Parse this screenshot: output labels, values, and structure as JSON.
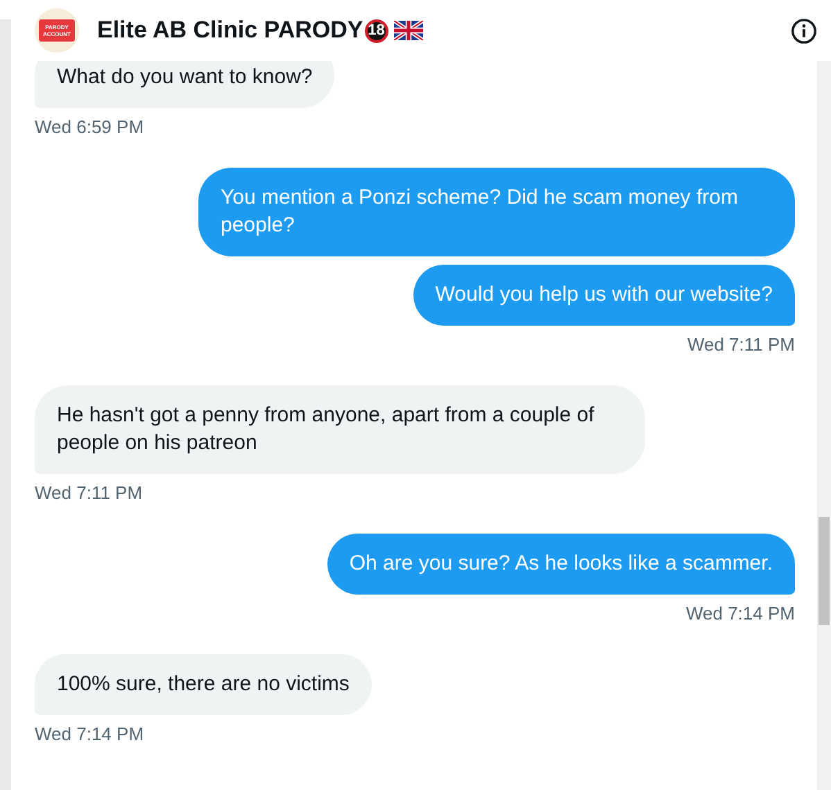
{
  "header": {
    "avatar_text": "PARODY ACCOUNT",
    "name": "Elite AB Clinic PARODY",
    "age_badge": "18"
  },
  "messages": [
    {
      "kind": "received",
      "text": "What do you want to know?",
      "timestamp": "Wed 6:59 PM"
    },
    {
      "kind": "sent",
      "text": "You mention a Ponzi scheme? Did he scam money from people?"
    },
    {
      "kind": "sent",
      "text": "Would you help us with our website?",
      "timestamp": "Wed 7:11 PM"
    },
    {
      "kind": "received",
      "text": "He hasn't got a penny from anyone, apart from a couple of people on his patreon",
      "timestamp": "Wed 7:11 PM"
    },
    {
      "kind": "sent",
      "text": "Oh are you sure? As he looks like a scammer.",
      "timestamp": "Wed 7:14 PM"
    },
    {
      "kind": "received",
      "text": "100% sure, there are no victims",
      "timestamp": "Wed 7:14 PM"
    }
  ]
}
